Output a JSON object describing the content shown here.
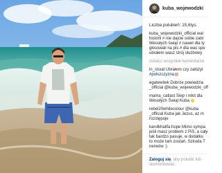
{
  "post": {
    "username": "kuba_wojewodzki",
    "likes": "Liczba polubień: 15,6tys."
  },
  "comments": [
    {
      "lines": [
        "kuba_wojewodzki_official wal",
        "historii # nie dajcie sobie zabr",
        "Wesołych świąt # nawet dla ty",
        "głosowali na pis # dla was spe",
        "ubrałem wasz strój służbowy"
      ]
    },
    {
      "lines": [
        "zobacz wszystkie komentarze"
      ],
      "muted": true
    },
    {
      "lines": [
        "in_cloud Ubrałem czy założył",
        "#polszczyzna"
      ],
      "link_line": 1
    },
    {
      "lines": [
        "egatewitek Dobrze powiedzia",
        "_official @kuba_wojewodzki_offi"
      ]
    },
    {
      "lines": [
        "mama_catlast Siep i mlot dla",
        "Wesołych Świąt Kuba"
      ]
    },
    {
      "lines": [
        "rebel20whitecolour @kuba",
        "_official Kuba jak Jezus, az m",
        "rozstępuje"
      ]
    },
    {
      "lines": [
        "karolkhalifa.hope Mimo sympa",
        "jeśli masz problem z PiS, a cały",
        "tak bardzo pasuje, w dodatku",
        "to może tam zostań. Szkoda T",
        "nerwów :)"
      ]
    }
  ],
  "footer": {
    "login": "Zaloguj się",
    "rest": ", aby polubić lub",
    "rest2": "skomentować."
  },
  "icons": {
    "avatar": "avatar",
    "brand_colors": {
      "text": "#262626",
      "muted": "#9a9a9a",
      "link": "#003569"
    }
  }
}
